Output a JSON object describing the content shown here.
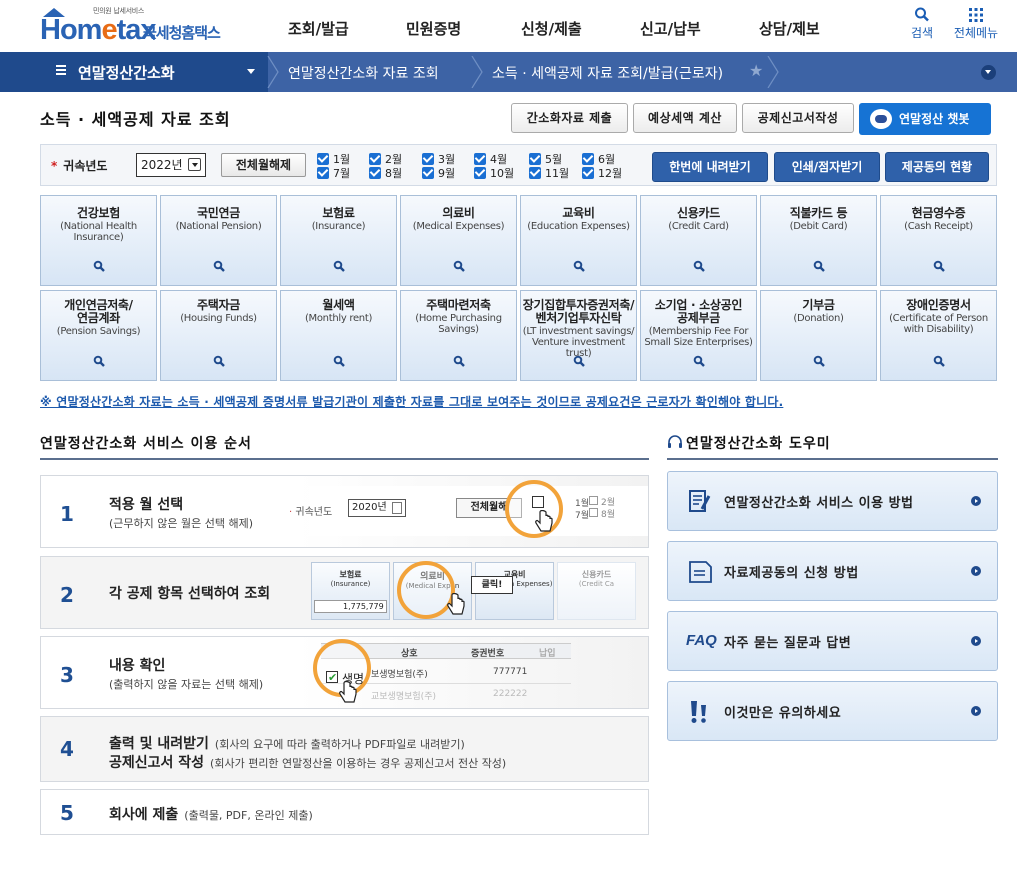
{
  "header": {
    "logo_tagline": "민의원 납세서비스",
    "logo_word": "Hometax",
    "logo_korean": "국세청홈택스",
    "nav": [
      "조회/발급",
      "민원증명",
      "신청/제출",
      "신고/납부",
      "상담/제보"
    ],
    "search_label": "검색",
    "all_menu_label": "전체메뉴"
  },
  "location": {
    "section": "연말정산간소화",
    "crumbs": [
      "연말정산간소화 자료 조회",
      "소득 · 세액공제 자료 조회/발급(근로자)"
    ]
  },
  "page": {
    "title": "소득 · 세액공제 자료 조회",
    "buttons": [
      "간소화자료 제출",
      "예상세액 계산",
      "공제신고서작성"
    ],
    "chatbot_label": "연말정산 챗봇"
  },
  "filter": {
    "year_label": "귀속년도",
    "year_value": "2022년",
    "uncheck_all_label": "전체월해제",
    "months": [
      "1월",
      "2월",
      "3월",
      "4월",
      "5월",
      "6월",
      "7월",
      "8월",
      "9월",
      "10월",
      "11월",
      "12월"
    ],
    "action_buttons": [
      "한번에 내려받기",
      "인쇄/점자받기",
      "제공동의 현황"
    ]
  },
  "categories": [
    {
      "ko": "건강보험",
      "en": "(National Health Insurance)"
    },
    {
      "ko": "국민연금",
      "en": "(National Pension)"
    },
    {
      "ko": "보험료",
      "en": "(Insurance)"
    },
    {
      "ko": "의료비",
      "en": "(Medical Expenses)"
    },
    {
      "ko": "교육비",
      "en": "(Education Expenses)"
    },
    {
      "ko": "신용카드",
      "en": "(Credit Card)"
    },
    {
      "ko": "직불카드 등",
      "en": "(Debit Card)"
    },
    {
      "ko": "현금영수증",
      "en": "(Cash Receipt)"
    },
    {
      "ko": "개인연금저축/\n연금계좌",
      "en": "(Pension Savings)"
    },
    {
      "ko": "주택자금",
      "en": "(Housing Funds)"
    },
    {
      "ko": "월세액",
      "en": "(Monthly rent)"
    },
    {
      "ko": "주택마련저축",
      "en": "(Home Purchasing Savings)"
    },
    {
      "ko": "장기집합투자증권저축/\n벤처기업투자신탁",
      "en": "(LT investment savings/ Venture investment trust)"
    },
    {
      "ko": "소기업 · 소상공인\n공제부금",
      "en": "(Membership Fee For Small Size Enterprises)"
    },
    {
      "ko": "기부금",
      "en": "(Donation)"
    },
    {
      "ko": "장애인증명서",
      "en": "(Certificate of Person with Disability)"
    }
  ],
  "notice": "※ 연말정산간소화 자료는 소득 · 세액공제 증명서류 발급기관이 제출한 자료를 그대로 보여주는 것이므로 공제요건은 근로자가 확인해야 합니다.",
  "steps_section": {
    "title": "연말정산간소화 서비스 이용 순서",
    "steps": [
      {
        "num": "1",
        "title": "적용 월 선택",
        "desc": "(근무하지 않은 월은 선택 해제)"
      },
      {
        "num": "2",
        "title": "각 공제 항목 선택하여 조회",
        "desc": ""
      },
      {
        "num": "3",
        "title": "내용 확인",
        "desc": "(출력하지 않을 자료는 선택 해제)"
      },
      {
        "num": "4",
        "title": "출력 및 내려받기",
        "desc": "(회사의 요구에 따라 출력하거나 PDF파일로 내려받기)",
        "title2": "공제신고서 작성",
        "desc2": "(회사가 편리한 연말정산을 이용하는 경우 공제신고서 전산 작성)"
      },
      {
        "num": "5",
        "title": "회사에 제출",
        "desc": "(출력물, PDF, 온라인 제출)"
      }
    ],
    "illus1": {
      "label": "귀속년도",
      "year": "2020년",
      "btn": "전체월해",
      "m1": "1월",
      "m2": "2월",
      "m7": "7월",
      "m8": "8월"
    },
    "illus2": {
      "c1": "보험료",
      "c1en": "(Insurance)",
      "c1val": "1,775,779",
      "c2": "의료비",
      "c2en": "(Medical Expen",
      "click": "클릭!",
      "c3": "교육비",
      "c3en": "(Education Expenses)",
      "c4": "신용카드",
      "c4en": "(Credit Ca"
    },
    "illus3": {
      "h1": "상호",
      "h2": "증권번호",
      "h3": "납입",
      "cell": "생명",
      "row1": "보생명보험(주)",
      "row1val": "777771",
      "row2": "교보생명보험(주)",
      "row2val": "222222"
    }
  },
  "helper": {
    "title": "연말정산간소화 도우미",
    "items": [
      {
        "label": "연말정산간소화 서비스 이용 방법",
        "icon": "document-pen-icon"
      },
      {
        "label": "자료제공동의 신청 방법",
        "icon": "document-icon"
      },
      {
        "label": "자주 묻는 질문과 답변",
        "prefix": "FAQ",
        "icon": "faq-icon"
      },
      {
        "label": "이것만은 유의하세요",
        "icon": "exclamation-icon"
      }
    ]
  },
  "colors": {
    "brand_blue": "#2a63b4",
    "brand_orange": "#e86c16",
    "nav_dark": "#1f4a8c",
    "nav_mid": "#3d63a5",
    "action_blue": "#2f61aa",
    "chatbot_blue": "#1673d4",
    "highlight_ring": "#f2a33a"
  }
}
